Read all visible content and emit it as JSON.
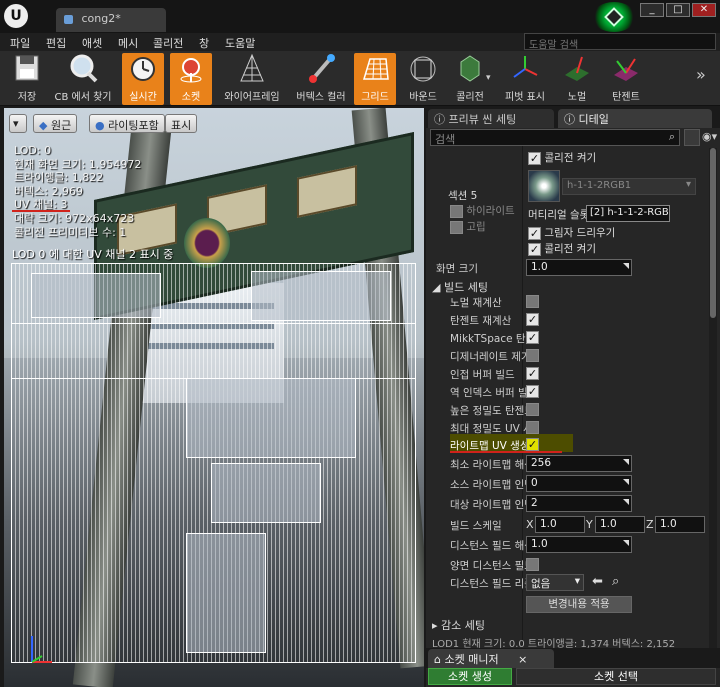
{
  "window": {
    "tab_title": "cong2*",
    "buttons": [
      "_",
      "□",
      "✕"
    ]
  },
  "menu": {
    "items": [
      "파일",
      "편집",
      "애셋",
      "메시",
      "콜리전",
      "창",
      "도움말"
    ],
    "help_search_placeholder": "도움말 검색"
  },
  "toolbar": {
    "buttons": [
      {
        "label": "저장",
        "icon": "save-icon"
      },
      {
        "label": "CB 에서 찾기",
        "icon": "find-in-browser-icon"
      },
      {
        "label": "실시간",
        "icon": "realtime-icon",
        "active": true
      },
      {
        "label": "소켓",
        "icon": "socket-icon",
        "active": true
      },
      {
        "label": "와이어프레임",
        "icon": "wireframe-icon"
      },
      {
        "label": "버텍스 컬러",
        "icon": "vertex-color-icon"
      },
      {
        "label": "그리드",
        "icon": "grid-icon",
        "active": true
      },
      {
        "label": "바운드",
        "icon": "bounds-icon"
      },
      {
        "label": "콜리전",
        "icon": "collision-icon"
      },
      {
        "label": "피벗 표시",
        "icon": "pivot-icon"
      },
      {
        "label": "노멀",
        "icon": "normals-icon"
      },
      {
        "label": "탄젠트",
        "icon": "tangents-icon"
      }
    ],
    "more": "»"
  },
  "viewport": {
    "controls": {
      "menu": "▾",
      "view": "원근",
      "lighting": "라이팅포함",
      "show": "표시"
    },
    "stats": [
      "LOD:  0",
      "현재 화면 크기: 1.954972",
      "트라이앵글: 1,822",
      "버텍스: 2,969",
      "UV 채널: 3",
      "대략 크기: 972x64x723",
      "콜리전 프리미티브 수: 1"
    ],
    "uv_channel_text": "LOD 0 에 대한 UV 채널 2 표시 중"
  },
  "details": {
    "tabs": [
      "프리뷰 씬 세팅",
      "디테일"
    ],
    "search_placeholder": "검색",
    "collision_enabled_top": "콜리전 켜기",
    "section": {
      "name": "섹션 5",
      "highlight": "하이라이트",
      "isolate": "고립",
      "material_name": "h-1-1-2RGB1",
      "material_slot_label": "머티리얼 슬롯",
      "material_slot_value": "[2] h-1-1-2-RGB",
      "cast_shadow": "그림자 드리우기",
      "enable_collision": "콜리전 켜기"
    },
    "screen_size": {
      "label": "화면 크기",
      "value": "1.0"
    },
    "build_settings": {
      "header": "빌드 세팅",
      "rows": [
        {
          "label": "노멀 재계산",
          "checked": false
        },
        {
          "label": "탄젠트 재계산",
          "checked": true
        },
        {
          "label": "MikkTSpace 탄젠",
          "checked": true
        },
        {
          "label": "디제너레이트 제거",
          "checked": false
        },
        {
          "label": "인접 버퍼 빌드",
          "checked": true
        },
        {
          "label": "역 인덱스 버퍼 빌드",
          "checked": true
        },
        {
          "label": "높은 정밀도 탄젠트",
          "checked": false
        },
        {
          "label": "최대 정밀도 UV 사",
          "checked": false
        },
        {
          "label": "라이트맵 UV 생성",
          "checked": true,
          "highlighted": true
        }
      ],
      "min_lightmap_res": {
        "label": "최소 라이트맵 해상",
        "value": "256"
      },
      "src_lightmap_index": {
        "label": "소스 라이트맵 인덱",
        "value": "0"
      },
      "dst_lightmap_index": {
        "label": "대상 라이트맵 인덱",
        "value": "2"
      },
      "build_scale": {
        "label": "빌드 스케일",
        "x": "1.0",
        "y": "1.0",
        "z": "1.0"
      },
      "df_resolution": {
        "label": "디스턴스 필드 해상",
        "value": "1.0"
      },
      "two_sided_df": {
        "label": "양면 디스턴스 필드",
        "checked": false
      },
      "df_replacement": {
        "label": "디스턴스 필드 리플",
        "value": "없음"
      },
      "apply_button": "변경내용 적용"
    },
    "reduction_settings": "감소 세팅",
    "lod_row": "LOD1     현재 크기: 0.0   트라이앵글: 1,374   버텍스: 2,152"
  },
  "socket_manager": {
    "tab": "소켓 매니저",
    "create": "소켓 생성",
    "select": "소켓 선택"
  },
  "colors": {
    "accent_orange": "#e9821a",
    "highlight_yellow": "#e0e000",
    "annotation_red": "#d0231b",
    "create_green": "#2f7d32"
  }
}
